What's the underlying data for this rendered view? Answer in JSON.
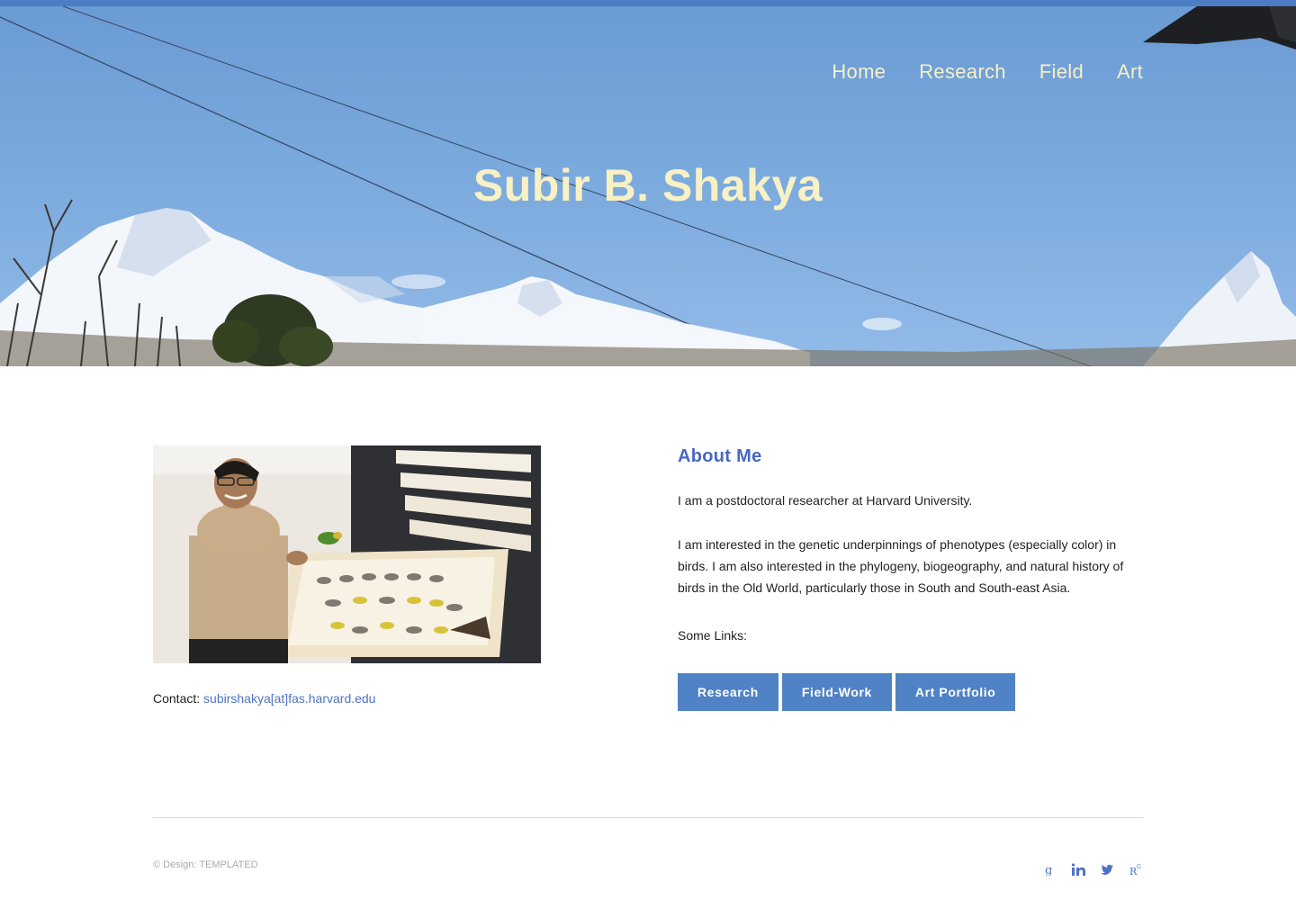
{
  "nav": {
    "items": [
      {
        "label": "Home"
      },
      {
        "label": "Research"
      },
      {
        "label": "Field"
      },
      {
        "label": "Art"
      }
    ]
  },
  "hero": {
    "title": "Subir B. Shakya"
  },
  "contact": {
    "label": "Contact:",
    "email": "subirshakya[at]fas.harvard.edu"
  },
  "about": {
    "heading": "About Me",
    "p1": "I am a postdoctoral researcher at Harvard University.",
    "p2": "I am interested in the genetic underpinnings of phenotypes (especially color) in birds. I am also interested in the phylogeny, biogeography, and natural history of birds in the Old World, particularly those in South and South-east Asia.",
    "links_label": "Some Links:",
    "buttons": [
      {
        "label": "Research"
      },
      {
        "label": "Field-Work"
      },
      {
        "label": "Art Portfolio"
      }
    ]
  },
  "footer": {
    "copyright": "© Design: TEMPLATED",
    "icons": [
      "google-scholar-icon",
      "linkedin-icon",
      "twitter-icon",
      "researchgate-icon"
    ]
  },
  "colors": {
    "accent": "#4767c2",
    "button": "#5083c6",
    "hero_text": "#f8f1c4"
  }
}
